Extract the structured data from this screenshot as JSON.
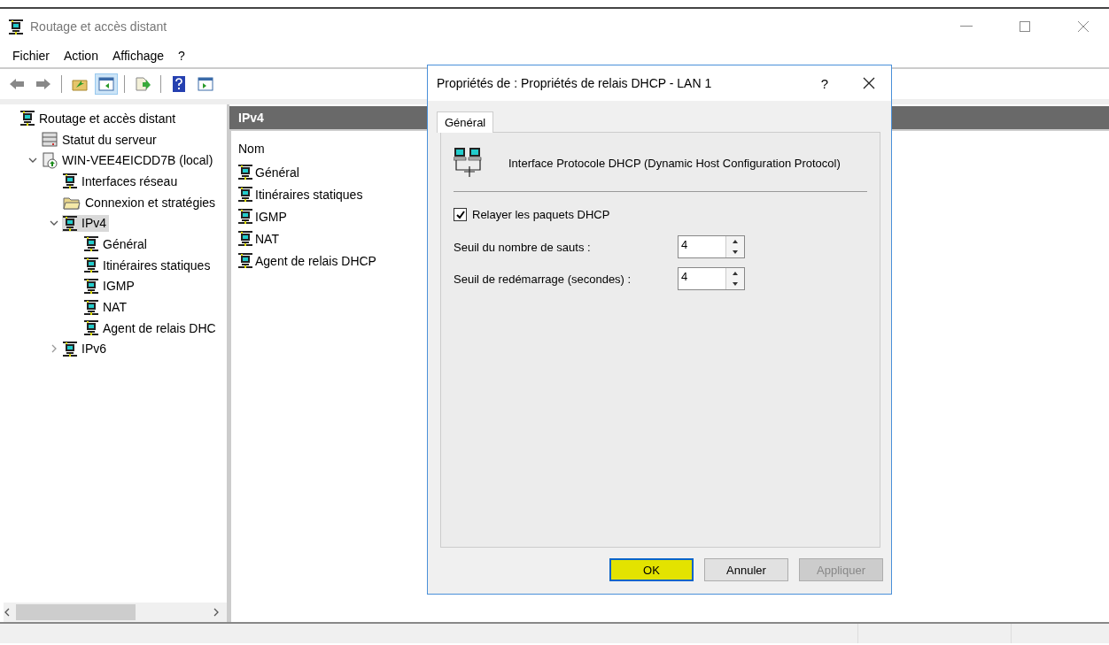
{
  "window": {
    "title": "Routage et accès distant"
  },
  "menu": [
    "Fichier",
    "Action",
    "Affichage",
    "?"
  ],
  "toolbar": [
    {
      "kind": "back"
    },
    {
      "kind": "forward"
    },
    {
      "kind": "separator"
    },
    {
      "kind": "up-folder"
    },
    {
      "kind": "tree",
      "pressed": true
    },
    {
      "kind": "separator"
    },
    {
      "kind": "export"
    },
    {
      "kind": "separator"
    },
    {
      "kind": "help"
    },
    {
      "kind": "pane"
    }
  ],
  "tree": [
    {
      "label": "Routage et accès distant",
      "kind": "router",
      "selected": false,
      "children": [
        {
          "label": "Statut du serveur",
          "kind": "status",
          "selected": false
        },
        {
          "label": "WIN-VEE4EICDD7B (local)",
          "kind": "server",
          "selected": false,
          "expanded": true,
          "children": [
            {
              "label": "Interfaces réseau",
              "kind": "router",
              "selected": false
            },
            {
              "label": "Connexion et stratégies",
              "kind": "folder",
              "selected": false
            },
            {
              "label": "IPv4",
              "kind": "router",
              "selected": true,
              "expanded": true,
              "children": [
                {
                  "label": "Général",
                  "kind": "router",
                  "selected": false
                },
                {
                  "label": "Itinéraires statiques",
                  "kind": "router",
                  "selected": false
                },
                {
                  "label": "IGMP",
                  "kind": "router",
                  "selected": false
                },
                {
                  "label": "NAT",
                  "kind": "router",
                  "selected": false
                },
                {
                  "label": "Agent de relais DHC",
                  "kind": "router",
                  "selected": false
                }
              ]
            },
            {
              "label": "IPv6",
              "kind": "router",
              "selected": false,
              "expanded": false
            }
          ]
        }
      ]
    }
  ],
  "content": {
    "header": "IPv4",
    "column": "Nom",
    "items": [
      "Général",
      "Itinéraires statiques",
      "IGMP",
      "NAT",
      "Agent de relais DHCP"
    ]
  },
  "dialog": {
    "title": "Propriétés de : Propriétés de relais DHCP - LAN 1",
    "help": "?",
    "tabs": [
      {
        "label": "Général",
        "selected": true
      }
    ],
    "description": "Interface Protocole DHCP (Dynamic Host Configuration Protocol)",
    "checkbox": {
      "label": "Relayer les paquets DHCP",
      "checked": true
    },
    "spinners": [
      {
        "label": "Seuil du nombre de sauts :",
        "value": "4"
      },
      {
        "label": "Seuil de redémarrage (secondes) :",
        "value": "4"
      }
    ],
    "buttons": [
      {
        "label": "OK",
        "default": true,
        "disabled": false
      },
      {
        "label": "Annuler",
        "default": false,
        "disabled": false
      },
      {
        "label": "Appliquer",
        "default": false,
        "disabled": true
      }
    ]
  }
}
